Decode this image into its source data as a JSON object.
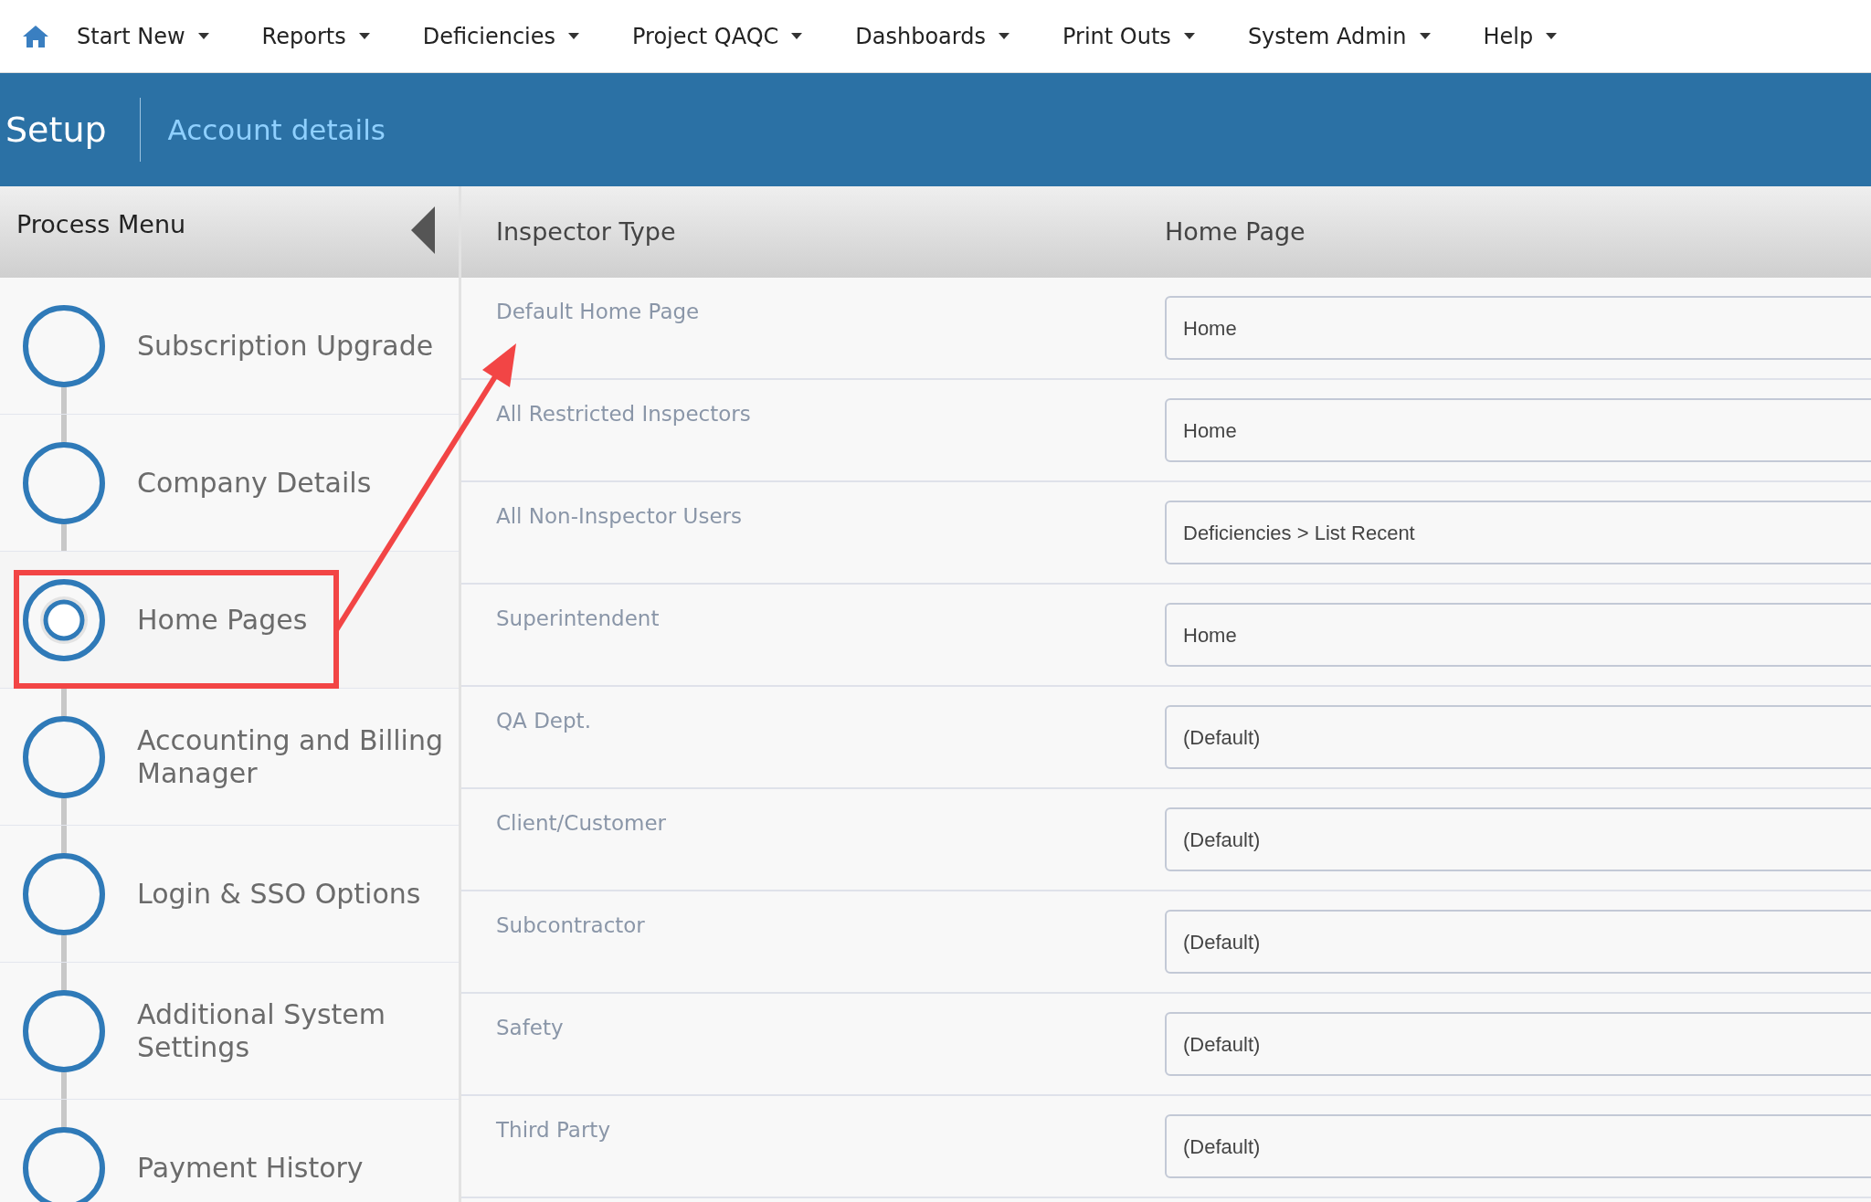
{
  "nav": {
    "items": [
      {
        "label": "Start New"
      },
      {
        "label": "Reports"
      },
      {
        "label": "Deficiencies"
      },
      {
        "label": "Project QAQC"
      },
      {
        "label": "Dashboards"
      },
      {
        "label": "Print Outs"
      },
      {
        "label": "System Admin"
      },
      {
        "label": "Help"
      }
    ]
  },
  "header": {
    "title": "Setup",
    "breadcrumb": "Account details"
  },
  "process_menu": {
    "title": "Process Menu",
    "items": [
      {
        "label": "Subscription Upgrade",
        "selected": false
      },
      {
        "label": "Company Details",
        "selected": false
      },
      {
        "label": "Home Pages",
        "selected": true
      },
      {
        "label": "Accounting and Billing Manager",
        "selected": false
      },
      {
        "label": "Login & SSO Options",
        "selected": false
      },
      {
        "label": "Additional System Settings",
        "selected": false
      },
      {
        "label": "Payment History",
        "selected": false
      }
    ]
  },
  "table": {
    "columns": [
      "Inspector Type",
      "Home Page"
    ],
    "rows": [
      {
        "type": "Default Home Page",
        "home_page": "Home"
      },
      {
        "type": "All Restricted Inspectors",
        "home_page": "Home"
      },
      {
        "type": "All Non-Inspector Users",
        "home_page": "Deficiencies > List Recent"
      },
      {
        "type": "Superintendent",
        "home_page": "Home"
      },
      {
        "type": "QA Dept.",
        "home_page": "(Default)"
      },
      {
        "type": "Client/Customer",
        "home_page": "(Default)"
      },
      {
        "type": "Subcontractor",
        "home_page": "(Default)"
      },
      {
        "type": "Safety",
        "home_page": "(Default)"
      },
      {
        "type": "Third Party",
        "home_page": "(Default)"
      }
    ]
  }
}
